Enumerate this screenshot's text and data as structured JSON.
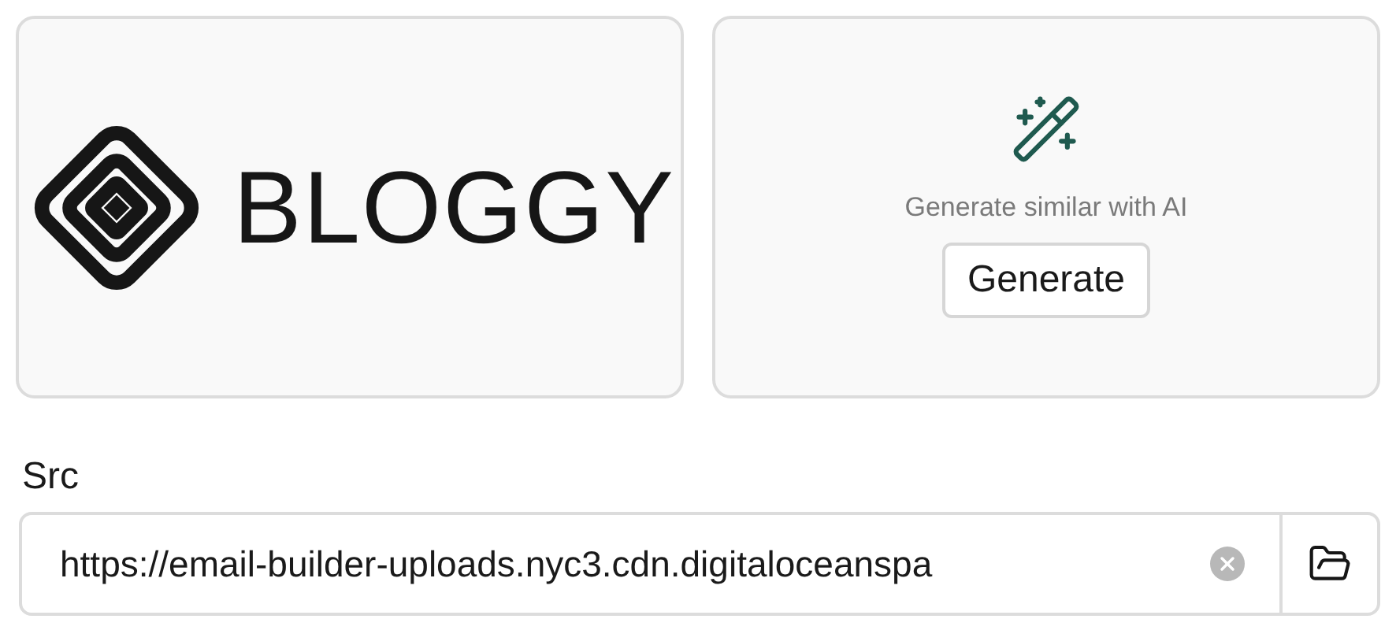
{
  "preview": {
    "logo_text": "BLOGGY"
  },
  "ai_panel": {
    "hint": "Generate similar with AI",
    "button": "Generate"
  },
  "src_field": {
    "label": "Src",
    "value": "https://email-builder-uploads.nyc3.cdn.digitaloceanspa"
  }
}
